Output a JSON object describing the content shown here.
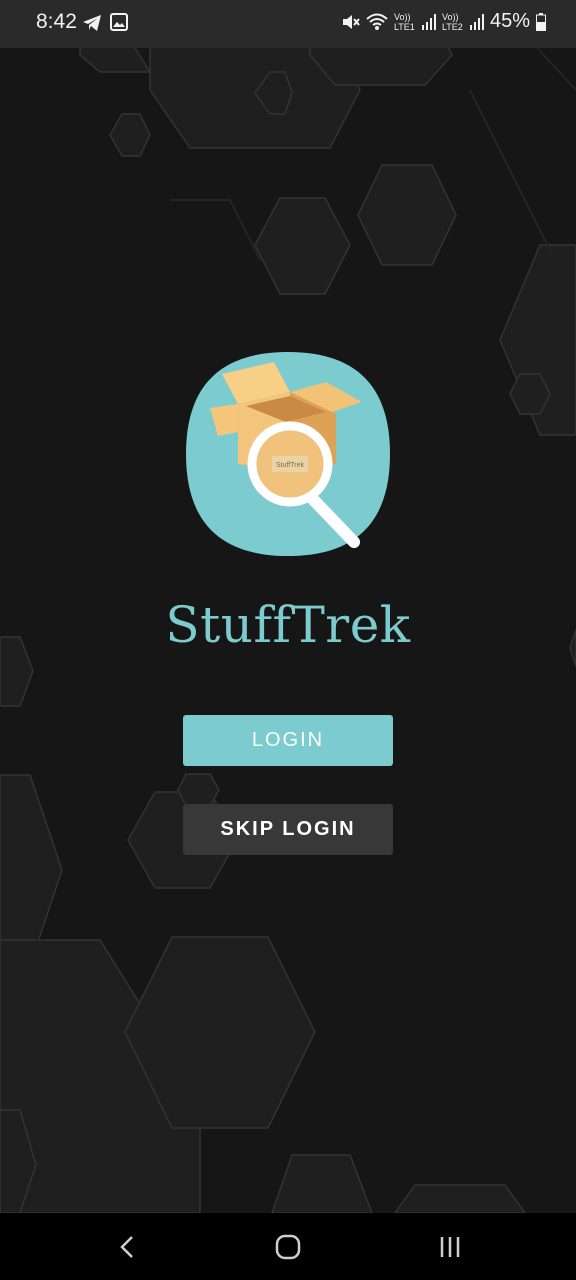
{
  "status_bar": {
    "time": "8:42",
    "battery": "45%",
    "sim1_label": "Vo)) LTE1",
    "sim2_label": "Vo)) LTE2",
    "icons": [
      "telegram-icon",
      "image-icon",
      "mute-icon",
      "wifi-icon",
      "signal-icon",
      "battery-icon"
    ]
  },
  "app": {
    "name": "StuffTrek",
    "logo_label": "StuffTrek"
  },
  "buttons": {
    "login": "LOGIN",
    "skip_login": "SKIP LOGIN"
  },
  "nav": {
    "back": "back-icon",
    "home": "home-icon",
    "recents": "recents-icon"
  },
  "colors": {
    "accent": "#7ccbcf",
    "background": "#161616",
    "secondary_button": "#383838"
  }
}
